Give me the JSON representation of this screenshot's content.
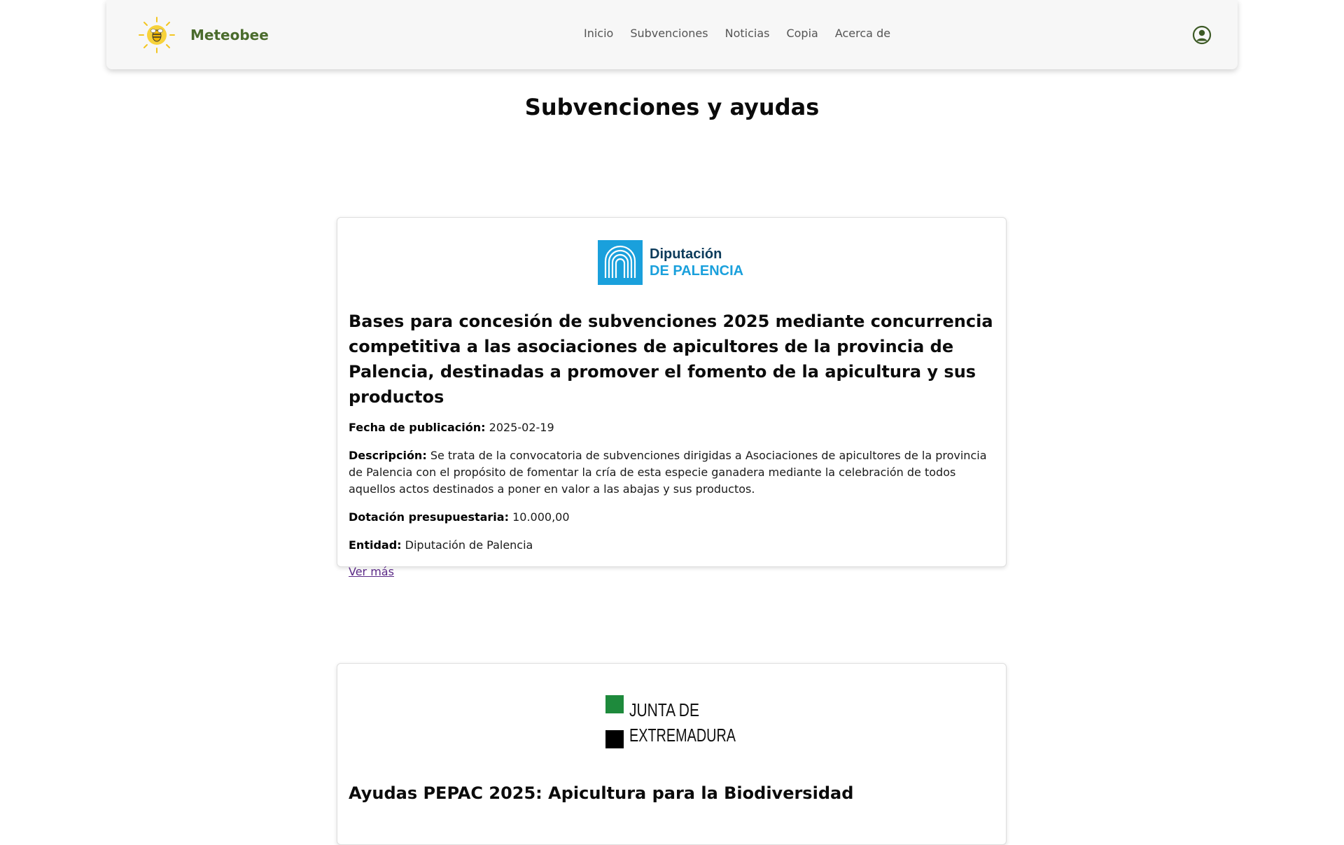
{
  "navbar": {
    "brand": {
      "name": "Meteobee",
      "logo_icon": "sun-bee-logo-icon"
    },
    "links": [
      {
        "label": "Inicio"
      },
      {
        "label": "Subvenciones"
      },
      {
        "label": "Noticias"
      },
      {
        "label": "Copia"
      },
      {
        "label": "Acerca de"
      }
    ],
    "user_icon": "user-circle-icon"
  },
  "page": {
    "title": "Subvenciones y ayudas"
  },
  "grants": [
    {
      "logo": {
        "line1": "Diputación",
        "line2": "DE PALENCIA",
        "color": "#1aa0dc"
      },
      "title": "Bases para concesión de subvenciones 2025 mediante concurrencia competitiva a las asociaciones de apicultores de la provincia de Palencia, destinadas a promover el fomento de la apicultura y sus productos",
      "fecha_label": "Fecha de publicación:",
      "fecha": "2025-02-19",
      "descripcion_label": "Descripción:",
      "descripcion": "Se trata de la convocatoria de subvenciones dirigidas a Asociaciones de apicultores de la provincia de Palencia con el propósito de fomentar la cría de esta especie ganadera mediante la celebración de todos aquellos actos destinados a poner en valor a las abajas y sus productos.",
      "dotacion_label": "Dotación presupuestaria:",
      "dotacion": "10.000,00",
      "entidad_label": "Entidad:",
      "entidad": "Diputación de Palencia",
      "link": "Ver más"
    },
    {
      "logo": {
        "line1": "JUNTA DE",
        "line2": "EXTREMADURA",
        "color": "#1e8a3c"
      },
      "title": "Ayudas PEPAC 2025: Apicultura para la Biodiversidad"
    }
  ],
  "colors": {
    "brand": "#4a6b2c",
    "link_visited": "#5b2a86",
    "nav_text": "#555555"
  }
}
